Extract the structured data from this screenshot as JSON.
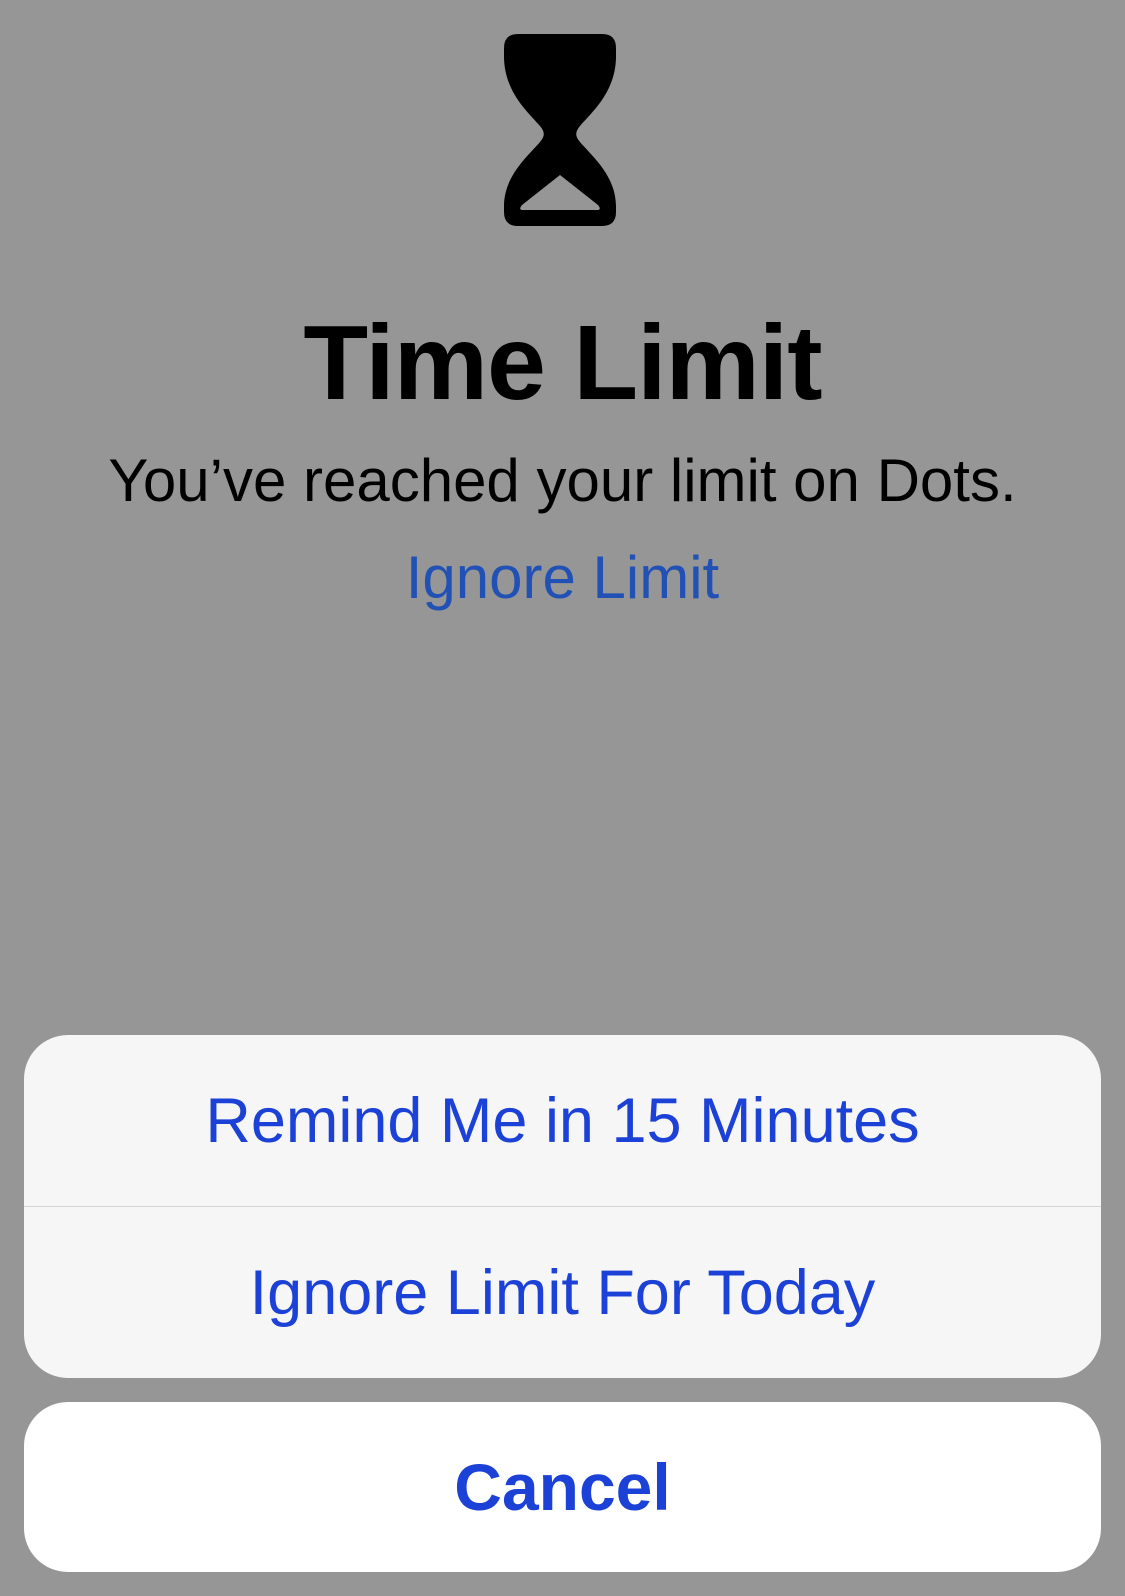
{
  "icon": "hourglass-icon",
  "title": "Time Limit",
  "message": "You’ve reached your limit on Dots.",
  "ignore_link": "Ignore Limit",
  "actions": [
    {
      "label": "Remind Me in 15 Minutes"
    },
    {
      "label": "Ignore Limit For Today"
    }
  ],
  "cancel_label": "Cancel",
  "colors": {
    "background": "#969696",
    "link": "#2151b5",
    "action": "#1c41d6",
    "sheet": "#f6f6f6",
    "cancel_bg": "#ffffff"
  }
}
